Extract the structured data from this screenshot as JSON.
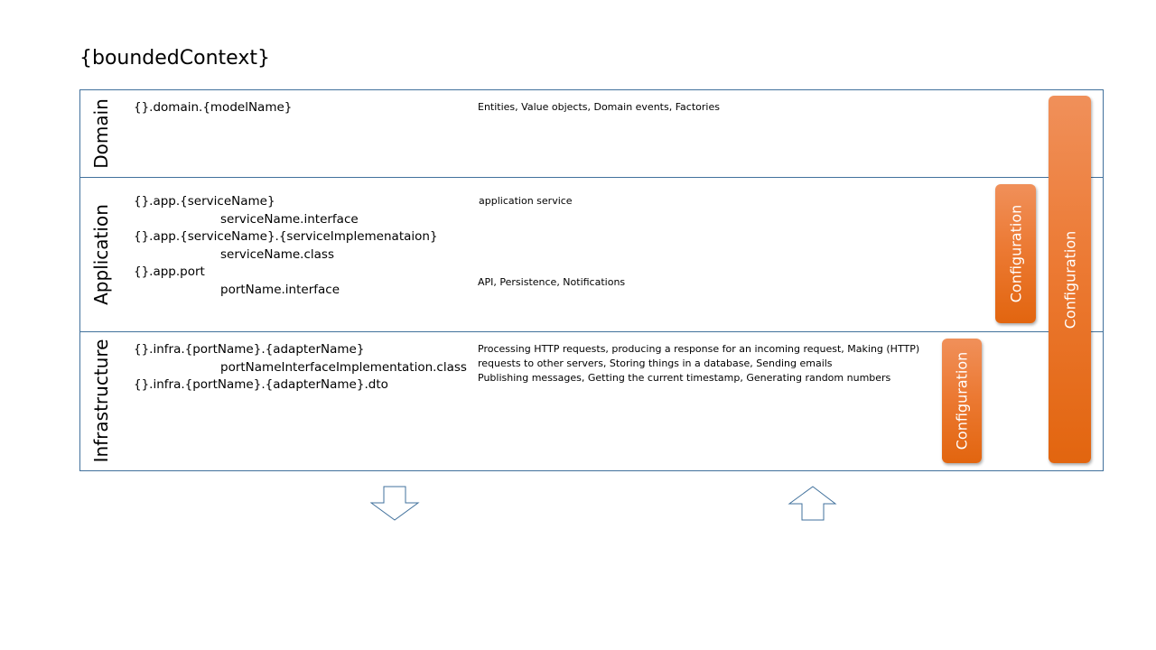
{
  "title": "{boundedContext}",
  "layers": {
    "domain": {
      "label": "Domain",
      "packages": [
        "{}.domain.{modelName}"
      ],
      "descriptions": [
        "Entities, Value objects, Domain events, Factories"
      ]
    },
    "application": {
      "label": "Application",
      "packages": [
        "{}.app.{serviceName}",
        "serviceName.interface",
        "{}.app.{serviceName}.{serviceImplemenataion}",
        "serviceName.class",
        "{}.app.port",
        "portName.interface"
      ],
      "descriptions": [
        "application service",
        "API, Persistence, Notifications"
      ]
    },
    "infrastructure": {
      "label": "Infrastructure",
      "packages": [
        "{}.infra.{portName}.{adapterName}",
        "portNameInterfaceImplementation.class",
        "{}.infra.{portName}.{adapterName}.dto"
      ],
      "descriptions": [
        "Processing HTTP requests, producing a response for an incoming request, Making (HTTP)",
        "requests to other servers, Storing things in a database, Sending emails",
        "Publishing messages, Getting the current timestamp, Generating random numbers"
      ]
    }
  },
  "configuration_bars": [
    {
      "label": "Configuration",
      "spans": "Infrastructure"
    },
    {
      "label": "Configuration",
      "spans": "Application"
    },
    {
      "label": "Configuration",
      "spans": "Domain to Infrastructure"
    }
  ],
  "arrows": [
    {
      "direction": "down",
      "color": "#41719c"
    },
    {
      "direction": "up",
      "color": "#41719c"
    }
  ],
  "colors": {
    "frame": "#41719c",
    "config_light": "#f0905a",
    "config_dark": "#e2650f"
  }
}
